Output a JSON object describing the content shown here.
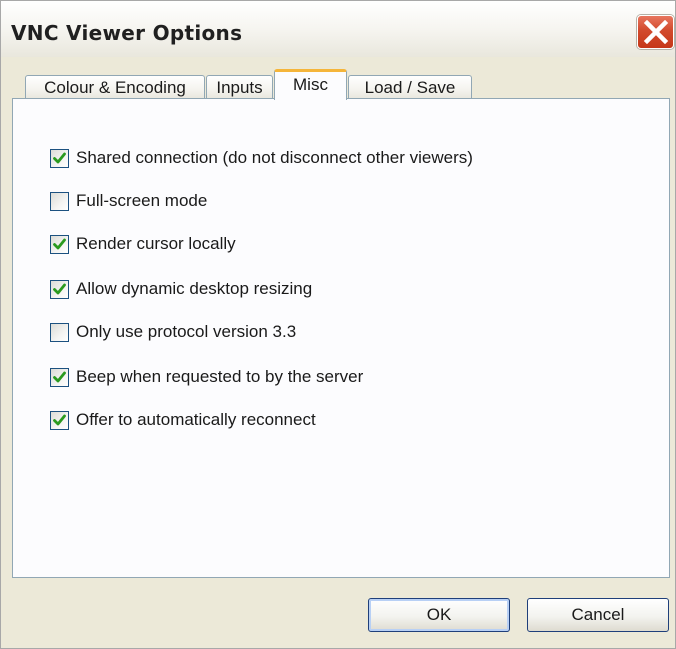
{
  "window": {
    "title": "VNC Viewer Options",
    "close_icon": "close-icon",
    "colors": {
      "close": "#d24a2d",
      "active_tab_accent": "#f5b53a",
      "check": "#2a9a1f"
    }
  },
  "tabs": [
    {
      "label": "Colour & Encoding",
      "active": false
    },
    {
      "label": "Inputs",
      "active": false
    },
    {
      "label": "Misc",
      "active": true
    },
    {
      "label": "Load / Save",
      "active": false
    }
  ],
  "options": [
    {
      "label": "Shared connection (do not disconnect other viewers)",
      "checked": true
    },
    {
      "label": "Full-screen mode",
      "checked": false
    },
    {
      "label": "Render cursor locally",
      "checked": true
    },
    {
      "label": "Allow dynamic desktop resizing",
      "checked": true
    },
    {
      "label": "Only use protocol version 3.3",
      "checked": false
    },
    {
      "label": "Beep when requested to by the server",
      "checked": true
    },
    {
      "label": "Offer to automatically reconnect",
      "checked": true
    }
  ],
  "buttons": {
    "ok_label": "OK",
    "cancel_label": "Cancel"
  }
}
